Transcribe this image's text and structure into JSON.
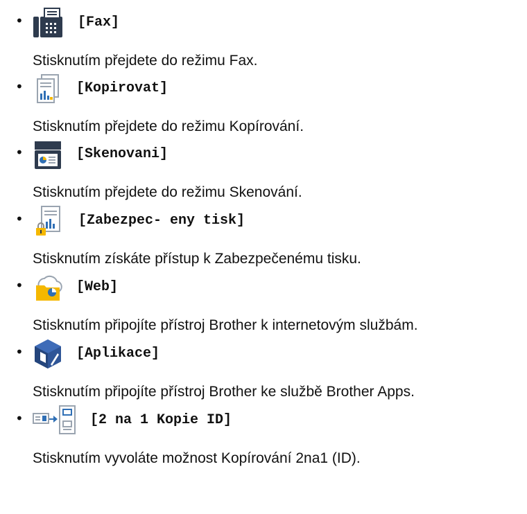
{
  "items": [
    {
      "icon": "fax-icon",
      "label": "[Fax]",
      "desc": "Stisknutím přejdete do režimu Fax."
    },
    {
      "icon": "copy-icon",
      "label": "[Kopirovat]",
      "desc": "Stisknutím přejdete do režimu Kopírování."
    },
    {
      "icon": "scan-icon",
      "label": "[Skenovani]",
      "desc": "Stisknutím přejdete do režimu Skenování."
    },
    {
      "icon": "secure-print-icon",
      "label": "[Zabezpec- eny tisk]",
      "desc": "Stisknutím získáte přístup k Zabezpečenému tisku."
    },
    {
      "icon": "web-icon",
      "label": "[Web]",
      "desc": "Stisknutím připojíte přístroj Brother k internetovým službám."
    },
    {
      "icon": "apps-icon",
      "label": "[Aplikace]",
      "desc": "Stisknutím připojíte přístroj Brother ke službě Brother Apps."
    },
    {
      "icon": "id-copy-icon",
      "label": "[2 na 1 Kopie ID]",
      "desc": "Stisknutím vyvoláte možnost Kopírování 2na1 (ID)."
    }
  ],
  "bullet": "•",
  "colors": {
    "icon_dark": "#2e3b4e",
    "icon_gray": "#b9c2cd",
    "accent_yellow": "#f5b800",
    "accent_blue": "#2f6fb5"
  }
}
